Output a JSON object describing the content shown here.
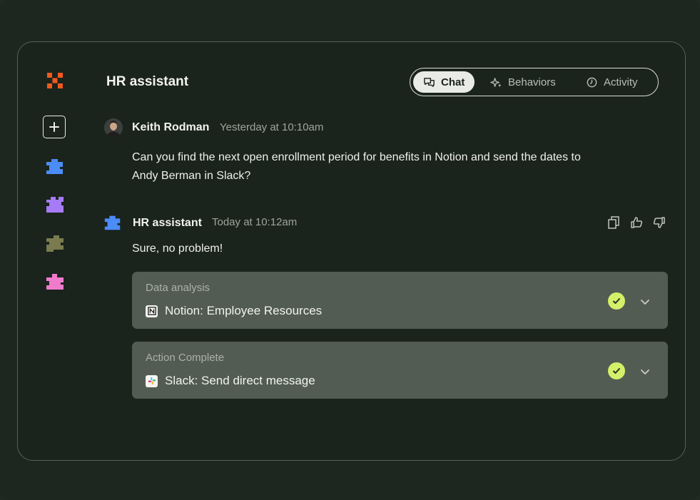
{
  "header": {
    "title": "HR assistant",
    "tabs": [
      {
        "label": "Chat",
        "icon": "chat-icon",
        "active": true
      },
      {
        "label": "Behaviors",
        "icon": "sparkle-icon",
        "active": false
      },
      {
        "label": "Activity",
        "icon": "clock-icon",
        "active": false
      }
    ]
  },
  "sidebar": {
    "logo_icon": "logo-icon",
    "new_icon": "plus-icon",
    "agents": [
      {
        "icon": "puzzle-icon",
        "color": "#4b8cf7"
      },
      {
        "icon": "puzzle-icon",
        "color": "#a57bf6"
      },
      {
        "icon": "puzzle-icon",
        "color": "#7a7b4f"
      },
      {
        "icon": "puzzle-icon",
        "color": "#f07bcd"
      }
    ]
  },
  "messages": [
    {
      "author": "Keith Rodman",
      "time": "Yesterday at 10:10am",
      "text_line1": "Can you find the next open enrollment period for benefits in Notion and send the dates to",
      "text_line2": "Andy Berman in Slack?"
    },
    {
      "author": "HR assistant",
      "time": "Today at 10:12am",
      "text": "Sure, no problem!"
    }
  ],
  "cards": [
    {
      "label": "Data analysis",
      "text": "Notion: Employee Resources",
      "icon": "notion-icon",
      "status": "complete"
    },
    {
      "label": "Action Complete",
      "text": "Slack: Send direct message",
      "icon": "slack-icon",
      "status": "complete"
    }
  ],
  "colors": {
    "accent_check": "#d3f06a",
    "logo": "#f0591f",
    "assistant_blue": "#4b8cf7"
  }
}
